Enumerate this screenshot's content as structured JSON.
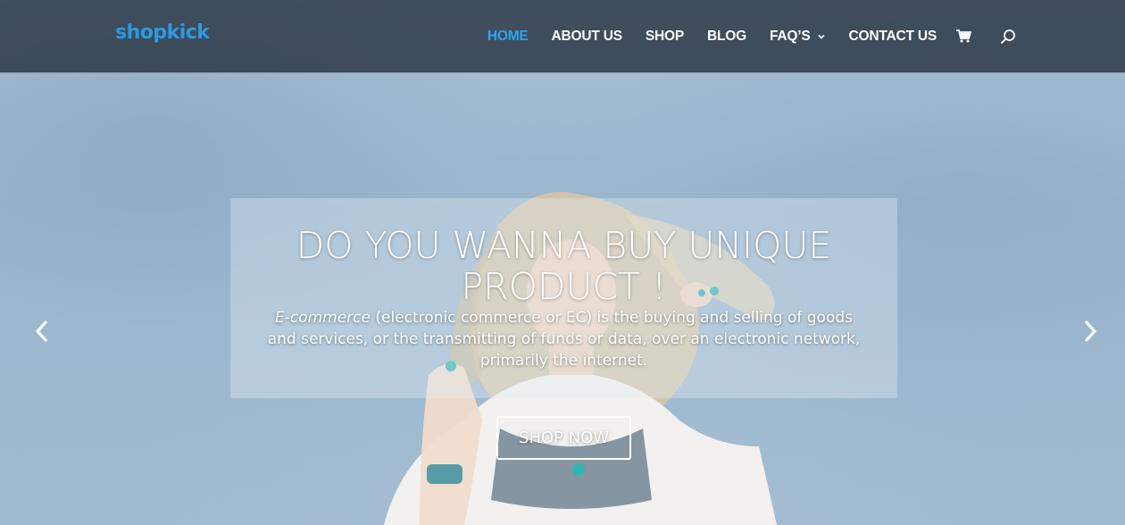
{
  "header": {
    "logo_text": "shopkick",
    "nav": [
      {
        "label": "HOME",
        "active": true
      },
      {
        "label": "ABOUT US",
        "active": false
      },
      {
        "label": "SHOP",
        "active": false
      },
      {
        "label": "BLOG",
        "active": false
      },
      {
        "label": "FAQ’S",
        "active": false,
        "has_dropdown": true
      },
      {
        "label": "CONTACT US",
        "active": false
      }
    ],
    "icons": [
      "cart-icon",
      "search-icon"
    ],
    "accent_color": "#2ea3f2",
    "logo_color": "#2b9be0"
  },
  "hero": {
    "headline": "DO YOU WANNA BUY UNIQUE PRODUCT !",
    "description_em": "E-commerce",
    "description_rest": " (electronic commerce or EC) is the buying and selling of goods and services, or the transmitting of funds or data, over an electronic network, primarily the internet.",
    "button_label": "SHOP NOW",
    "prev_icon": "chevron-left-icon",
    "next_icon": "chevron-right-icon"
  }
}
